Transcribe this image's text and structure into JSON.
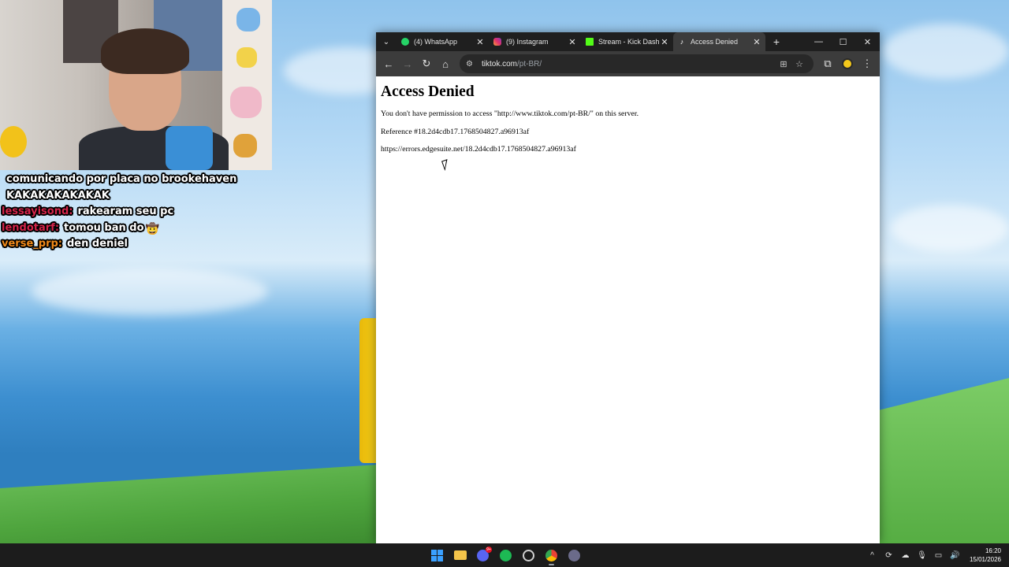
{
  "chat": [
    {
      "user": "",
      "message": "comunicando por placa no brookehaven",
      "user_color": "#ffffff"
    },
    {
      "user": "",
      "message": "KAKAKAKAKAKAK",
      "user_color": "#ffffff"
    },
    {
      "user": "lessayisond:",
      "message": "rakearam seu pc",
      "user_color": "#d4244a"
    },
    {
      "user": "lendotarf:",
      "message": "tomou ban do",
      "user_color": "#d4244a"
    },
    {
      "user": "verse_prp:",
      "message": "den deniel",
      "user_color": "#f08a1a"
    }
  ],
  "browser": {
    "tabs": [
      {
        "title": "(4) WhatsApp",
        "favicon_color": "#25d366",
        "icon": "whatsapp-icon"
      },
      {
        "title": "(9) Instagram",
        "favicon_color": "#e1306c",
        "icon": "instagram-icon"
      },
      {
        "title": "Stream - Kick Dash",
        "favicon_color": "#53fc18",
        "icon": "kick-icon"
      },
      {
        "title": "Access Denied",
        "favicon_color": "#ffffff",
        "icon": "tiktok-icon"
      }
    ],
    "url_host": "tiktok.com",
    "url_path": "/pt-BR/"
  },
  "page": {
    "heading": "Access Denied",
    "message": "You don't have permission to access \"http://www.tiktok.com/pt-BR/\" on this server.",
    "reference": "Reference #18.2d4cdb17.1768504827.a96913af",
    "error_url": "https://errors.edgesuite.net/18.2d4cdb17.1768504827.a96913af"
  },
  "taskbar": {
    "time": "16:20",
    "date": "15/01/2026",
    "discord_badge": "9+"
  }
}
